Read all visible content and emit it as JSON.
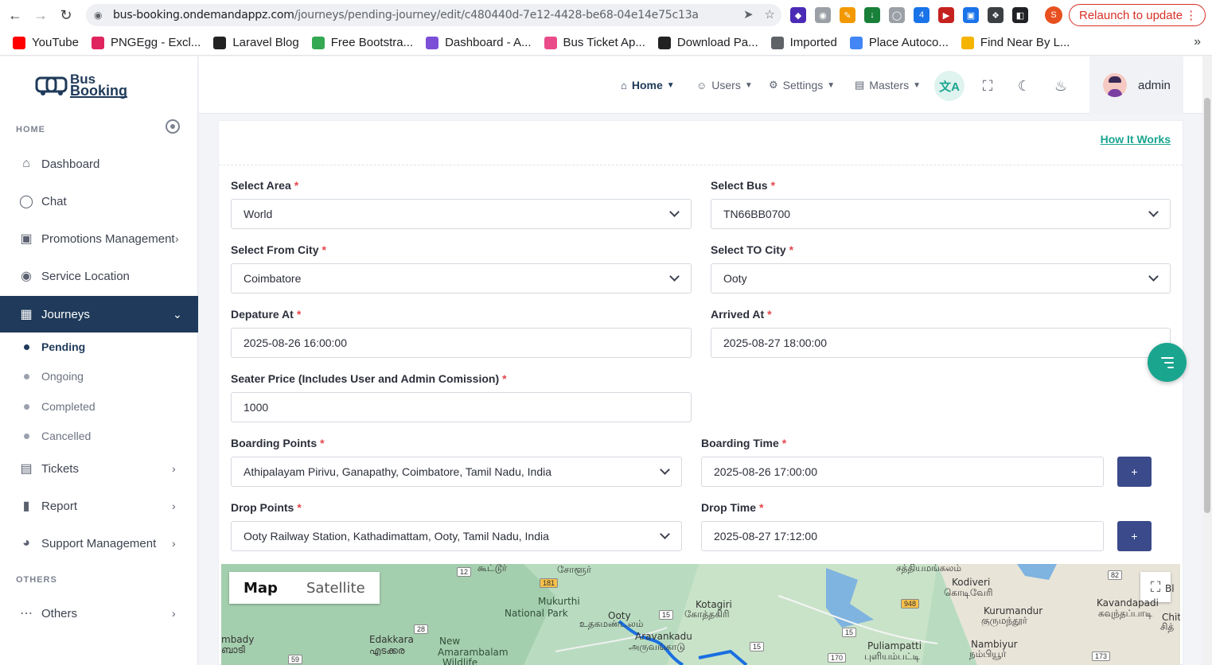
{
  "browser": {
    "url_host": "bus-booking.ondemandappz.com",
    "url_path": "/journeys/pending-journey/edit/c480440d-7e12-4428-be68-04e14e75c13a",
    "relaunch_label": "Relaunch to update",
    "profile_initial": "S",
    "extension_badge": "4"
  },
  "bookmarks": [
    {
      "label": "YouTube",
      "color": "#ff0000"
    },
    {
      "label": "PNGEgg - Excl...",
      "color": "#e0245e"
    },
    {
      "label": "Laravel Blog",
      "color": "#222222"
    },
    {
      "label": "Free Bootstra...",
      "color": "#34a853"
    },
    {
      "label": "Dashboard - A...",
      "color": "#7b4fd6"
    },
    {
      "label": "Bus Ticket Ap...",
      "color": "#ea4c89"
    },
    {
      "label": "Download Pa...",
      "color": "#222222"
    },
    {
      "label": "Imported",
      "color": "#5f6368"
    },
    {
      "label": "Place Autoco...",
      "color": "#4285f4"
    },
    {
      "label": "Find Near By L...",
      "color": "#f4b400"
    }
  ],
  "logo": {
    "line1": "Bus",
    "line2": "Booking"
  },
  "sidebar": {
    "section_home": "HOME",
    "section_others": "OTHERS",
    "items": [
      {
        "label": "Dashboard",
        "icon": "home-icon"
      },
      {
        "label": "Chat",
        "icon": "chat-icon"
      },
      {
        "label": "Promotions Management",
        "icon": "gift-icon"
      },
      {
        "label": "Service Location",
        "icon": "map-pin-icon"
      },
      {
        "label": "Journeys",
        "icon": "map-icon"
      },
      {
        "label": "Tickets",
        "icon": "ticket-icon"
      },
      {
        "label": "Report",
        "icon": "report-icon"
      },
      {
        "label": "Support Management",
        "icon": "headset-icon"
      },
      {
        "label": "Others",
        "icon": "more-icon"
      }
    ],
    "journey_sub": [
      "Pending",
      "Ongoing",
      "Completed",
      "Cancelled"
    ]
  },
  "topnav": {
    "home": "Home",
    "users": "Users",
    "settings": "Settings",
    "masters": "Masters",
    "user_name": "admin"
  },
  "form": {
    "how_it_works": "How It Works",
    "area_label": "Select Area",
    "area_value": "World",
    "bus_label": "Select Bus",
    "bus_value": "TN66BB0700",
    "from_label": "Select From City",
    "from_value": "Coimbatore",
    "to_label": "Select TO City",
    "to_value": "Ooty",
    "depart_label": "Depature At",
    "depart_value": "2025-08-26 16:00:00",
    "arrive_label": "Arrived At",
    "arrive_value": "2025-08-27 18:00:00",
    "price_label": "Seater Price (Includes User and Admin Comission)",
    "price_value": "1000",
    "boarding_label": "Boarding Points",
    "boarding_value": "Athipalayam Pirivu, Ganapathy, Coimbatore, Tamil Nadu, India",
    "boarding_time_label": "Boarding Time",
    "boarding_time_value": "2025-08-26 17:00:00",
    "drop_label": "Drop Points",
    "drop_value": "Ooty Railway Station, Kathadimattam, Ooty, Tamil Nadu, India",
    "drop_time_label": "Drop Time",
    "drop_time_value": "2025-08-27 17:12:00",
    "plus": "+",
    "required_mark": "*"
  },
  "map": {
    "tab_map": "Map",
    "tab_satellite": "Satellite",
    "labels": [
      "Mukurthi",
      "National Park",
      "Ooty",
      "உதகமண்டலம்",
      "Kotagiri",
      "கோத்தகிரி",
      "Aravankadu",
      "அருவங்காடு",
      "Edakkara",
      "എടക്കര",
      "New",
      "Amarambalam",
      "Wildlife",
      "mbady",
      "ബാടി",
      "Kodiveri",
      "கொடிவேரி",
      "Kurumandur",
      "குருமந்தூர்",
      "Kavandapadi",
      "கவுந்தப்பாடி",
      "Puliampatti",
      "புளியம்பட்டி",
      "Nambiyur",
      "நம்பியூர்",
      "சத்தியமங்கலம்",
      "சோளூர்",
      "கூட்டூர்",
      "Chith",
      "சித்",
      "Bl"
    ],
    "roads": [
      "12",
      "181",
      "28",
      "59",
      "15",
      "948",
      "15",
      "15",
      "170",
      "173",
      "82"
    ]
  }
}
